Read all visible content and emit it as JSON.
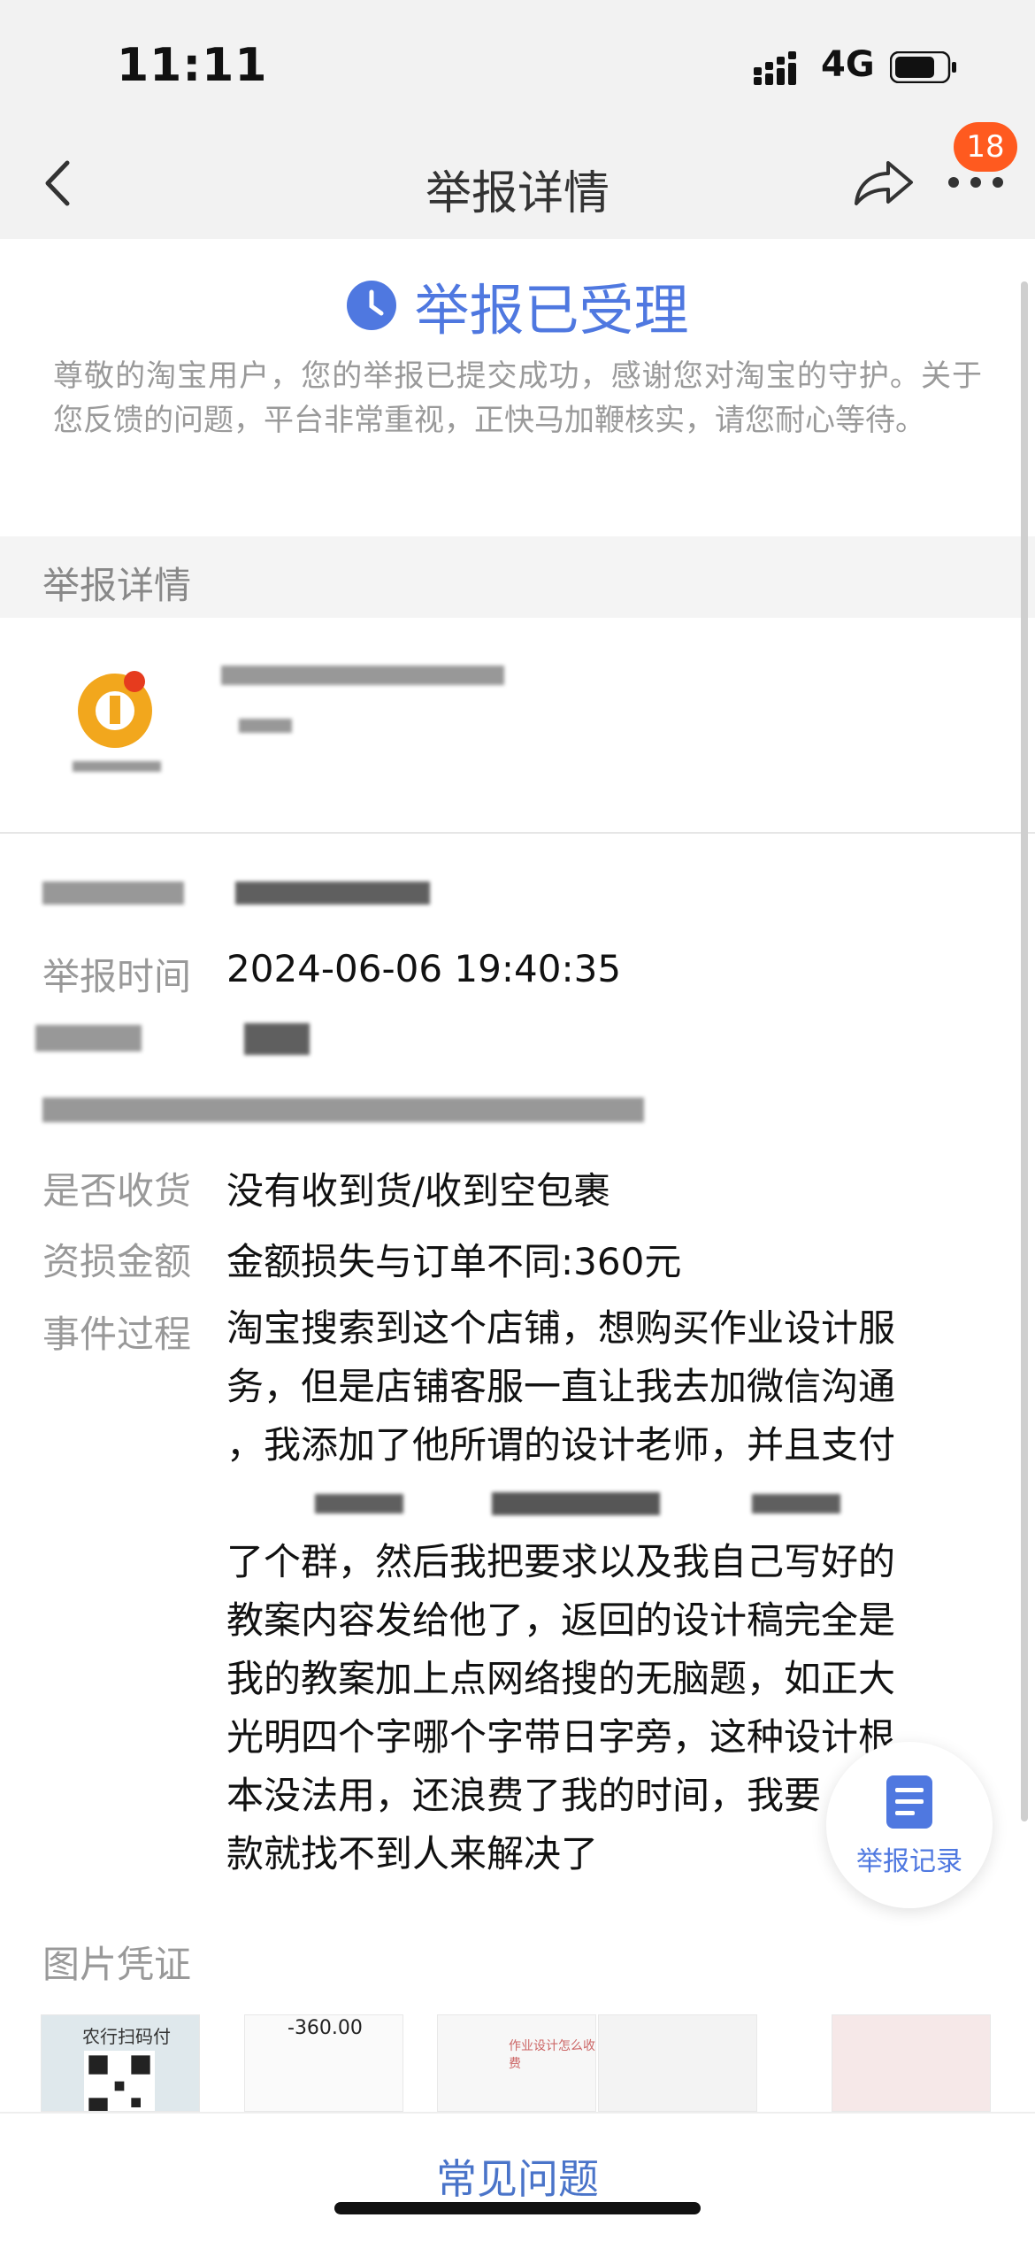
{
  "status_bar": {
    "time": "11:11",
    "network": "4G"
  },
  "nav": {
    "title": "举报详情",
    "badge": "18"
  },
  "report_status": {
    "title": "举报已受理",
    "description": "尊敬的淘宝用户，您的举报已提交成功，感谢您对淘宝的守护。关于您反馈的问题，平台非常重视，正快马加鞭核实，请您耐心等待。"
  },
  "section": {
    "title": "举报详情"
  },
  "details": {
    "report_time_label": "举报时间",
    "report_time_value": "2024-06-06 19:40:35",
    "received_label": "是否收货",
    "received_value": "没有收到货/收到空包裹",
    "loss_label": "资损金额",
    "loss_value": "金额损失与订单不同:360元",
    "process_label": "事件过程",
    "process_lines": [
      "淘宝搜索到这个店铺，想购买作业设计服",
      "务，但是店铺客服一直让我去加微信沟通",
      "，我添加了他所谓的设计老师，并且支付",
      "",
      "了个群，然后我把要求以及我自己写好的",
      "教案内容发给他了，返回的设计稿完全是",
      "我的教案加上点网络搜的无脑题，如正大",
      "光明四个字哪个字带日字旁，这种设计根",
      "本没法用，还浪费了我的时间，我要",
      "款就找不到人来解决了"
    ]
  },
  "images": {
    "title": "图片凭证",
    "thumb1_text": "农行扫码付",
    "thumb2_text": "-360.00",
    "thumb3_text": "作业设计怎么收费"
  },
  "fab": {
    "label": "举报记录"
  },
  "bottom": {
    "faq": "常见问题"
  },
  "colors": {
    "accent": "#4f78e0",
    "badge": "#ff5a1f"
  }
}
